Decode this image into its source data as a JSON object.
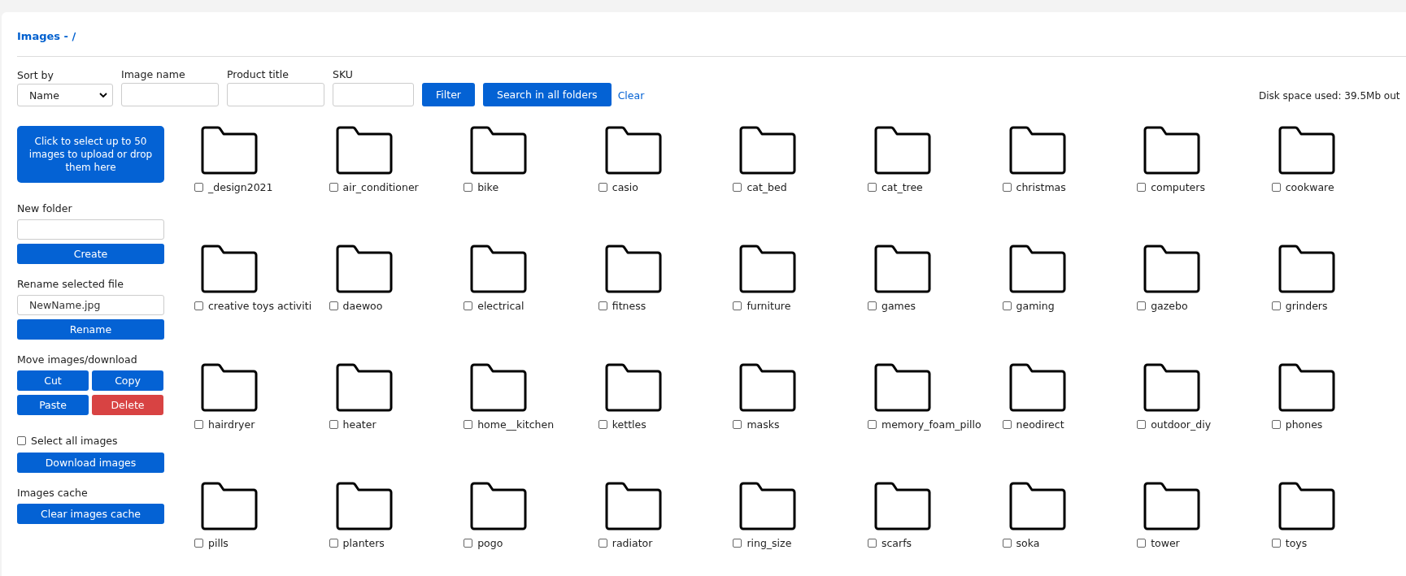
{
  "title": "Images - /",
  "filters": {
    "sort_label": "Sort by",
    "sort_value": "Name",
    "image_name_label": "Image name",
    "product_title_label": "Product title",
    "sku_label": "SKU",
    "filter_button": "Filter",
    "search_all_button": "Search in all folders",
    "clear_link": "Clear"
  },
  "disk_space": "Disk space used: 39.5Mb out",
  "sidebar": {
    "upload_button": "Click to select up to 50 images to upload or drop them here",
    "new_folder_label": "New folder",
    "create_button": "Create",
    "rename_label": "Rename selected file",
    "rename_placeholder": "NewName.jpg",
    "rename_button": "Rename",
    "move_label": "Move images/download",
    "cut_button": "Cut",
    "copy_button": "Copy",
    "paste_button": "Paste",
    "delete_button": "Delete",
    "select_all": {
      "label": "Select all images",
      "checked": false
    },
    "download_button": "Download images",
    "cache_label": "Images cache",
    "clear_cache_button": "Clear images cache"
  },
  "folders": [
    {
      "name": "_design2021",
      "checked": false
    },
    {
      "name": "air_conditioner",
      "checked": false
    },
    {
      "name": "bike",
      "checked": false
    },
    {
      "name": "casio",
      "checked": false
    },
    {
      "name": "cat_bed",
      "checked": false
    },
    {
      "name": "cat_tree",
      "checked": false
    },
    {
      "name": "christmas",
      "checked": false
    },
    {
      "name": "computers",
      "checked": false
    },
    {
      "name": "cookware",
      "checked": false
    },
    {
      "name": "creative toys activiti",
      "checked": false
    },
    {
      "name": "daewoo",
      "checked": false
    },
    {
      "name": "electrical",
      "checked": false
    },
    {
      "name": "fitness",
      "checked": false
    },
    {
      "name": "furniture",
      "checked": false
    },
    {
      "name": "games",
      "checked": false
    },
    {
      "name": "gaming",
      "checked": false
    },
    {
      "name": "gazebo",
      "checked": false
    },
    {
      "name": "grinders",
      "checked": false
    },
    {
      "name": "hairdryer",
      "checked": false
    },
    {
      "name": "heater",
      "checked": false
    },
    {
      "name": "home__kitchen",
      "checked": false
    },
    {
      "name": "kettles",
      "checked": false
    },
    {
      "name": "masks",
      "checked": false
    },
    {
      "name": "memory_foam_pillo",
      "checked": false
    },
    {
      "name": "neodirect",
      "checked": false
    },
    {
      "name": "outdoor_diy",
      "checked": false
    },
    {
      "name": "phones",
      "checked": false
    },
    {
      "name": "pills",
      "checked": false
    },
    {
      "name": "planters",
      "checked": false
    },
    {
      "name": "pogo",
      "checked": false
    },
    {
      "name": "radiator",
      "checked": false
    },
    {
      "name": "ring_size",
      "checked": false
    },
    {
      "name": "scarfs",
      "checked": false
    },
    {
      "name": "soka",
      "checked": false
    },
    {
      "name": "tower",
      "checked": false
    },
    {
      "name": "toys",
      "checked": false
    }
  ]
}
